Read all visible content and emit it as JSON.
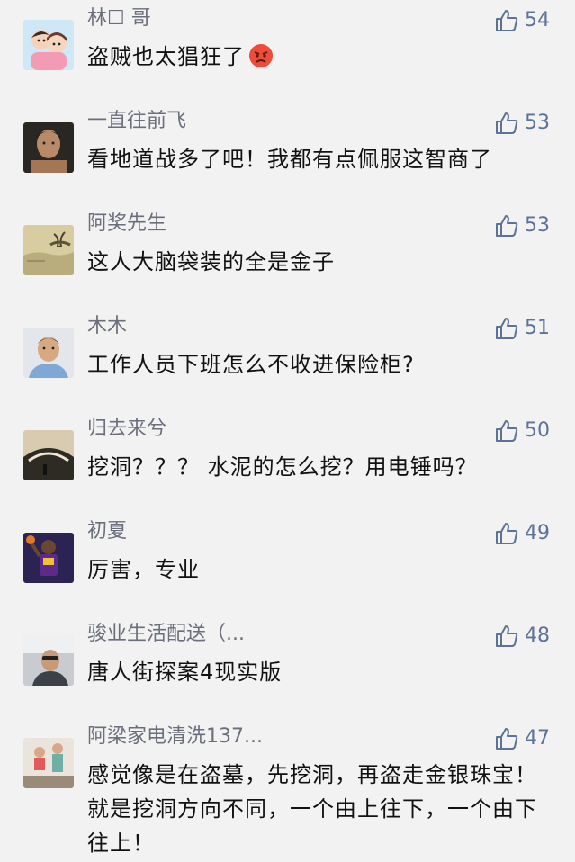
{
  "comments": [
    {
      "name": "林☐ 哥",
      "text": "盗贼也太猖狂了",
      "likes": "54",
      "avatar": "cartoon-couple-avatar",
      "emoji": "angry-face-icon"
    },
    {
      "name": "一直往前飞",
      "text": "看地道战多了吧！我都有点佩服这智商了",
      "likes": "53",
      "avatar": "man-portrait-avatar"
    },
    {
      "name": "阿奖先生",
      "text": "这人大脑袋装的全是金子",
      "likes": "53",
      "avatar": "landscape-painting-avatar"
    },
    {
      "name": "木木",
      "text": "工作人员下班怎么不收进保险柜?",
      "likes": "51",
      "avatar": "man-selfie-avatar"
    },
    {
      "name": "归去来兮",
      "text": "挖洞？？？ 水泥的怎么挖？用电锤吗？",
      "likes": "50",
      "avatar": "landscape-photo-avatar"
    },
    {
      "name": "初夏",
      "text": "厉害，专业",
      "likes": "49",
      "avatar": "basketball-player-avatar"
    },
    {
      "name": "骏业生活配送（...",
      "text": "唐人街探案4现实版",
      "likes": "48",
      "avatar": "man-in-car-avatar"
    },
    {
      "name": "阿梁家电清洗137...",
      "text": "感觉像是在盗墓，先挖洞，再盗走金银珠宝！就是挖洞方向不同，一个由上往下，一个由下往上！",
      "likes": "47",
      "avatar": "family-photo-avatar"
    }
  ],
  "colors": {
    "background": "#f2f2f2",
    "name": "#6b6f7c",
    "text": "#111111",
    "like": "#5d7396"
  },
  "icons": {
    "like": "thumbs-up-icon"
  }
}
